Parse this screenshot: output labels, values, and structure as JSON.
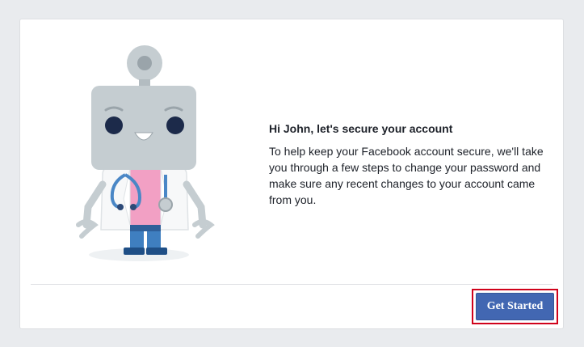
{
  "colors": {
    "page_background": "#e9ebee",
    "card_background": "#ffffff",
    "button_background": "#4267b2",
    "highlight_border": "#d0021b",
    "robot_head": "#c5cdd1",
    "robot_shirt": "#f2a0c4",
    "robot_pants": "#3f7fc0",
    "robot_eyes": "#1c2a4a"
  },
  "illustration": {
    "icon": "doctor-robot-illustration"
  },
  "message": {
    "heading": "Hi John, let's secure your account",
    "body": "To help keep your Facebook account secure, we'll take you through a few steps to change your password and make sure any recent changes to your account came from you."
  },
  "actions": {
    "get_started_label": "Get Started"
  }
}
